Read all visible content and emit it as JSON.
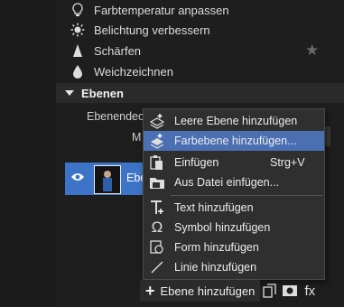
{
  "tools": [
    {
      "label": "Farbtemperatur anpassen",
      "icon": "lightbulb-icon"
    },
    {
      "label": "Belichtung verbessern",
      "icon": "sun-icon"
    },
    {
      "label": "Schärfen",
      "icon": "sharpen-triangle-icon"
    },
    {
      "label": "Weichzeichnen",
      "icon": "drop-icon"
    }
  ],
  "section": {
    "title": "Ebenen"
  },
  "layers_panel": {
    "opacity_label": "Ebenendeck",
    "mode_label": "M",
    "layer_name": "Ebe"
  },
  "context_menu": {
    "items": [
      {
        "label": "Leere Ebene hinzufügen",
        "icon": "layers-add-icon",
        "shortcut": ""
      },
      {
        "label": "Farbebene hinzufügen...",
        "icon": "color-layer-icon",
        "shortcut": "",
        "highlighted": true
      },
      {
        "label": "Einfügen",
        "icon": "paste-icon",
        "shortcut": "Strg+V"
      },
      {
        "label": "Aus Datei einfügen...",
        "icon": "file-insert-icon",
        "shortcut": ""
      },
      {
        "label": "Text hinzufügen",
        "icon": "text-icon",
        "shortcut": ""
      },
      {
        "label": "Symbol hinzufügen",
        "icon": "omega-icon",
        "shortcut": ""
      },
      {
        "label": "Form hinzufügen",
        "icon": "shape-icon",
        "shortcut": ""
      },
      {
        "label": "Linie hinzufügen",
        "icon": "line-icon",
        "shortcut": ""
      }
    ]
  },
  "bottom_bar": {
    "add_layer_label": "Ebene hinzufügen",
    "fx_label": "fx"
  },
  "colors": {
    "background": "#1e1e1e",
    "highlight": "#4a6fb3",
    "selected_layer": "#3d74c7"
  }
}
